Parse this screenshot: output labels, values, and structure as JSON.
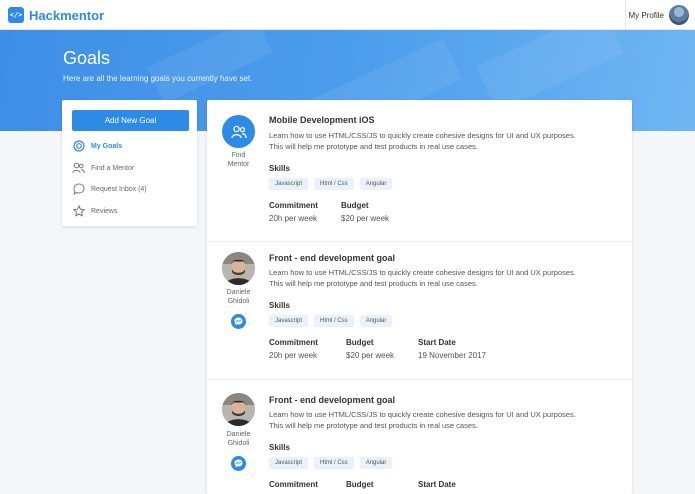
{
  "app": {
    "logo_glyph": "</>",
    "name": "Hackmentor",
    "accent": "#2d8ae6"
  },
  "header": {
    "profile_label": "My Profile"
  },
  "hero": {
    "title": "Goals",
    "subtitle": "Here are all the learning goals you currently have set."
  },
  "sidebar": {
    "add_button": "Add New Goal",
    "items": [
      {
        "label": "My Goals",
        "icon": "target-icon",
        "active": true
      },
      {
        "label": "Find a Mentor",
        "icon": "users-icon",
        "active": false
      },
      {
        "label": "Request Inbox (4)",
        "icon": "chat-bubble-icon",
        "active": false
      },
      {
        "label": "Reviews",
        "icon": "star-icon",
        "active": false
      }
    ]
  },
  "goals": [
    {
      "title": "Mobile Development iOS",
      "description_line1": "Learn how to use HTML/CSS/JS to quickly create cohesive designs for UI and UX purposes.",
      "description_line2": "This will help me prototype and test products in real use cases.",
      "skills_title": "Skills",
      "skills": [
        "Javascript",
        "Html / Css",
        "Angular"
      ],
      "find_mentor_label1": "Find",
      "find_mentor_label2": "Mentor",
      "commitment_label": "Commitment",
      "commitment": "20h per week",
      "budget_label": "Budget",
      "budget": "$20 per week"
    },
    {
      "title": "Front - end development goal",
      "description_line1": "Learn how to use HTML/CSS/JS to quickly create cohesive designs for UI and UX purposes.",
      "description_line2": "This will help me prototype and test products in real use cases.",
      "skills_title": "Skills",
      "skills": [
        "Javascript",
        "Html / Css",
        "Angular"
      ],
      "mentor_first": "Daniele",
      "mentor_last": "Ghidoli",
      "commitment_label": "Commitment",
      "commitment": "20h per week",
      "budget_label": "Budget",
      "budget": "$20 per week",
      "start_label": "Start Date",
      "start": "19 November 2017"
    },
    {
      "title": "Front - end development goal",
      "description_line1": "Learn how to use HTML/CSS/JS to quickly create cohesive designs for UI and UX purposes.",
      "description_line2": "This will help me prototype and test products in real use cases.",
      "skills_title": "Skills",
      "skills": [
        "Javascript",
        "Html / Css",
        "Angular"
      ],
      "mentor_first": "Daniele",
      "mentor_last": "Ghidoli",
      "commitment_label": "Commitment",
      "budget_label": "Budget",
      "start_label": "Start Date"
    }
  ]
}
